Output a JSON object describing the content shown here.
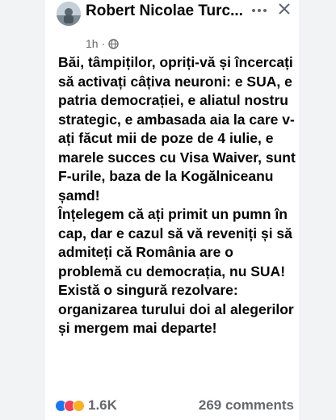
{
  "post": {
    "author": "Robert Nicolae Turc...",
    "time": "1h",
    "separator": "·",
    "text": "Băi, tâmpiților, opriți-vă și încercați să activați câțiva neuroni: e SUA, e patria democrației, e aliatul nostru strategic, e ambasada aia la care v-ați făcut mii de poze de 4 iulie, e marele succes cu Visa Waiver, sunt F-urile, baza de la Kogălniceanu șamd!\nÎnțelegem că ați primit un pumn în cap, dar e cazul să vă reveniți și să admiteți că România are o problemă cu democrația, nu SUA!\nExistă o singură rezolvare: organizarea turului doi al alegerilor și mergem mai departe!",
    "reactions_count": "1.6K",
    "comments_label": "269 comments",
    "menu_icon": "more-horizontal-icon",
    "close_icon": "close-icon",
    "privacy_icon": "globe-icon"
  }
}
